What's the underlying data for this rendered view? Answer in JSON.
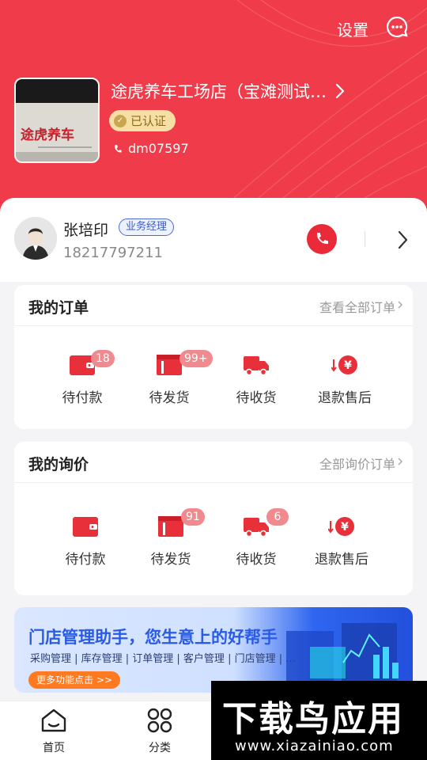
{
  "header": {
    "settings_label": "设置",
    "store_name": "途虎养车工场店（宝滩测试…",
    "verified_label": "已认证",
    "account": "dm07597",
    "store_sign_text": "途虎养车"
  },
  "manager": {
    "name": "张培印",
    "role": "业务经理",
    "phone": "18217797211"
  },
  "orders": {
    "title": "我的订单",
    "view_all": "查看全部订单",
    "items": [
      {
        "label": "待付款",
        "badge": "18",
        "icon": "wallet-icon"
      },
      {
        "label": "待发货",
        "badge": "99+",
        "icon": "box-icon"
      },
      {
        "label": "待收货",
        "badge": "",
        "icon": "truck-icon"
      },
      {
        "label": "退款售后",
        "badge": "",
        "icon": "refund-icon"
      }
    ]
  },
  "inquiries": {
    "title": "我的询价",
    "view_all": "全部询价订单",
    "items": [
      {
        "label": "待付款",
        "badge": "",
        "icon": "wallet-icon"
      },
      {
        "label": "待发货",
        "badge": "91",
        "icon": "box-icon"
      },
      {
        "label": "待收货",
        "badge": "6",
        "icon": "truck-icon"
      },
      {
        "label": "退款售后",
        "badge": "",
        "icon": "refund-icon"
      }
    ]
  },
  "banner": {
    "title": "门店管理助手，您生意上的好帮手",
    "subtitle": "采购管理 | 库存管理 | 订单管理 | 客户管理 | 门店管理 | ...",
    "button": "更多功能点击 >>"
  },
  "tabbar": {
    "items": [
      {
        "label": "首页",
        "icon": "home-icon"
      },
      {
        "label": "分类",
        "icon": "category-icon"
      }
    ]
  },
  "watermark": {
    "main": "下载鸟应用",
    "url": "www.xiazainiao.com"
  },
  "colors": {
    "brand_red": "#ef3b4a",
    "badge": "#f08a8f",
    "accent_blue": "#2a5be6"
  }
}
